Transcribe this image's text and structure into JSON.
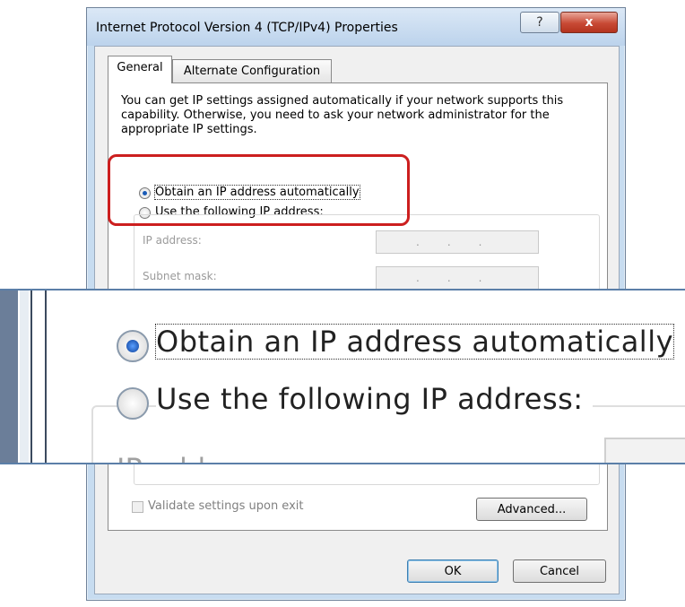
{
  "window": {
    "title": "Internet Protocol Version 4 (TCP/IPv4) Properties",
    "help_glyph": "?",
    "close_glyph": "x"
  },
  "tabs": [
    {
      "label": "General",
      "selected": true
    },
    {
      "label": "Alternate Configuration",
      "selected": false
    }
  ],
  "general": {
    "description": "You can get IP settings assigned automatically if your network supports this capability. Otherwise, you need to ask your network administrator for the appropriate IP settings.",
    "radio_auto": {
      "label": "Obtain an IP address automatically",
      "checked": true
    },
    "radio_manual": {
      "label": "Use the following IP address:",
      "checked": false
    },
    "fields": {
      "ip_label": "IP address:",
      "ip_value": "...",
      "subnet_label": "Subnet mask:",
      "subnet_value": "..."
    },
    "validate_label": "Validate settings upon exit",
    "advanced_label": "Advanced..."
  },
  "zoom": {
    "radio_auto_label": "Obtain an IP address automatically",
    "radio_manual_label": "Use the following IP address:",
    "partial_label": "IP address:"
  },
  "footer": {
    "ok_label": "OK",
    "cancel_label": "Cancel"
  },
  "colors": {
    "highlight": "#cc1f1f",
    "title_bg": "#c7dcf0",
    "radio_selected": "#1a5bb6"
  }
}
